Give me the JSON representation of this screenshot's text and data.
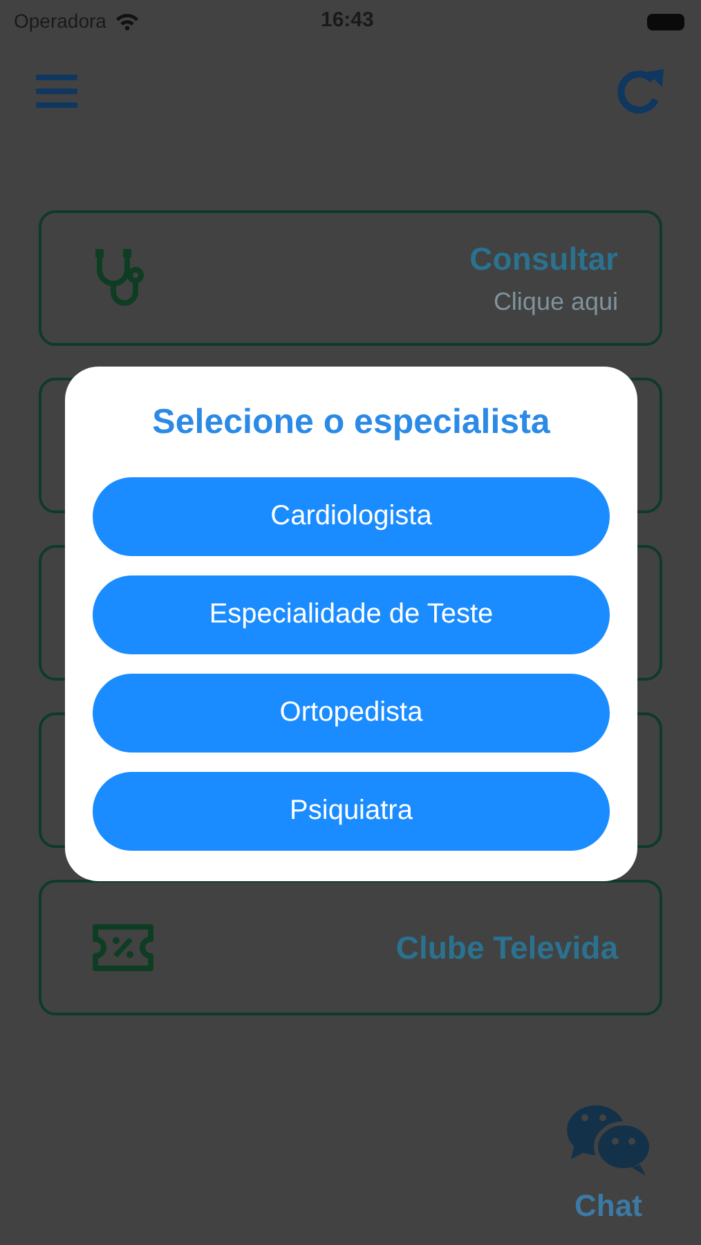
{
  "status_bar": {
    "carrier": "Operadora",
    "time": "16:43"
  },
  "cards": [
    {
      "kind": "stethoscope",
      "title": "Consultar",
      "subtitle": "Clique aqui"
    },
    {
      "kind": "covered"
    },
    {
      "kind": "covered"
    },
    {
      "kind": "covered"
    },
    {
      "kind": "ticket",
      "title": "Clube Televida"
    }
  ],
  "chat": {
    "label": "Chat"
  },
  "dialog": {
    "title": "Selecione o especialista",
    "options": [
      "Cardiologista",
      "Especialidade de Teste",
      "Ortopedista",
      "Psiquiatra"
    ]
  }
}
